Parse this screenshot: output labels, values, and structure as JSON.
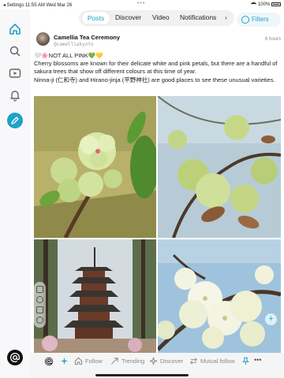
{
  "status_bar": {
    "left": "◂ Settings  11:55 AM  Wed Mar 26",
    "center": "•••",
    "right": "100%"
  },
  "tabs": [
    "Posts",
    "Discover",
    "Video",
    "Notifications"
  ],
  "filters_label": "Filters",
  "post": {
    "display_name": "Camellia Tea Ceremony",
    "handle": "@camelliakyoto",
    "time": "6 hours",
    "text_line1": "🤍🌸NOT ALL PINK💚💛",
    "text_line2": "Cherry blossoms are known for their delicate white and pink petals, but there are a handful of sakura trees that show off different colours at this time of year.",
    "text_line3": "Ninna-ji (仁和寺) and Hirano-jinja (平野神社) are good places to see these unusual varieties."
  },
  "photos": [
    "green-sakura-blossom",
    "green-sakura-branch",
    "pagoda",
    "white-sakura-cluster"
  ],
  "bottom_bar": {
    "follow": "Follow",
    "trending": "Trending",
    "discover": "Discover",
    "mutual_follow": "Mutual follow",
    "more": "•••"
  },
  "colors": {
    "accent": "#1fa2c8"
  }
}
